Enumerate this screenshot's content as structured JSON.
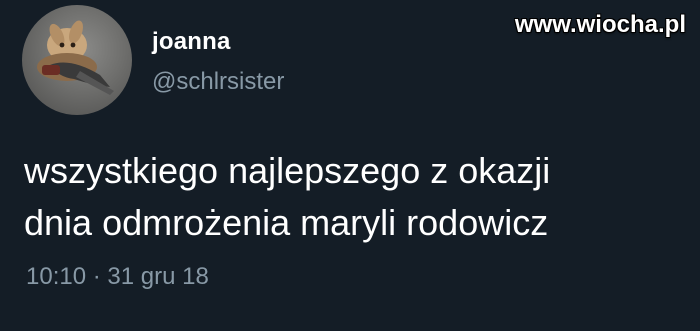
{
  "user": {
    "display_name": "joanna",
    "handle": "@schlrsister",
    "avatar_icon": "rabbit-avatar-image"
  },
  "tweet": {
    "lines": [
      "wszystkiego najlepszego z okazji",
      "dnia odmrożenia maryli rodowicz"
    ],
    "time": "10:10",
    "separator": "·",
    "date": "31 gru 18"
  },
  "watermark": {
    "text": "www.wiocha.pl"
  },
  "colors": {
    "background": "#141d26",
    "primary_text": "#ffffff",
    "secondary_text": "#8899a6"
  }
}
